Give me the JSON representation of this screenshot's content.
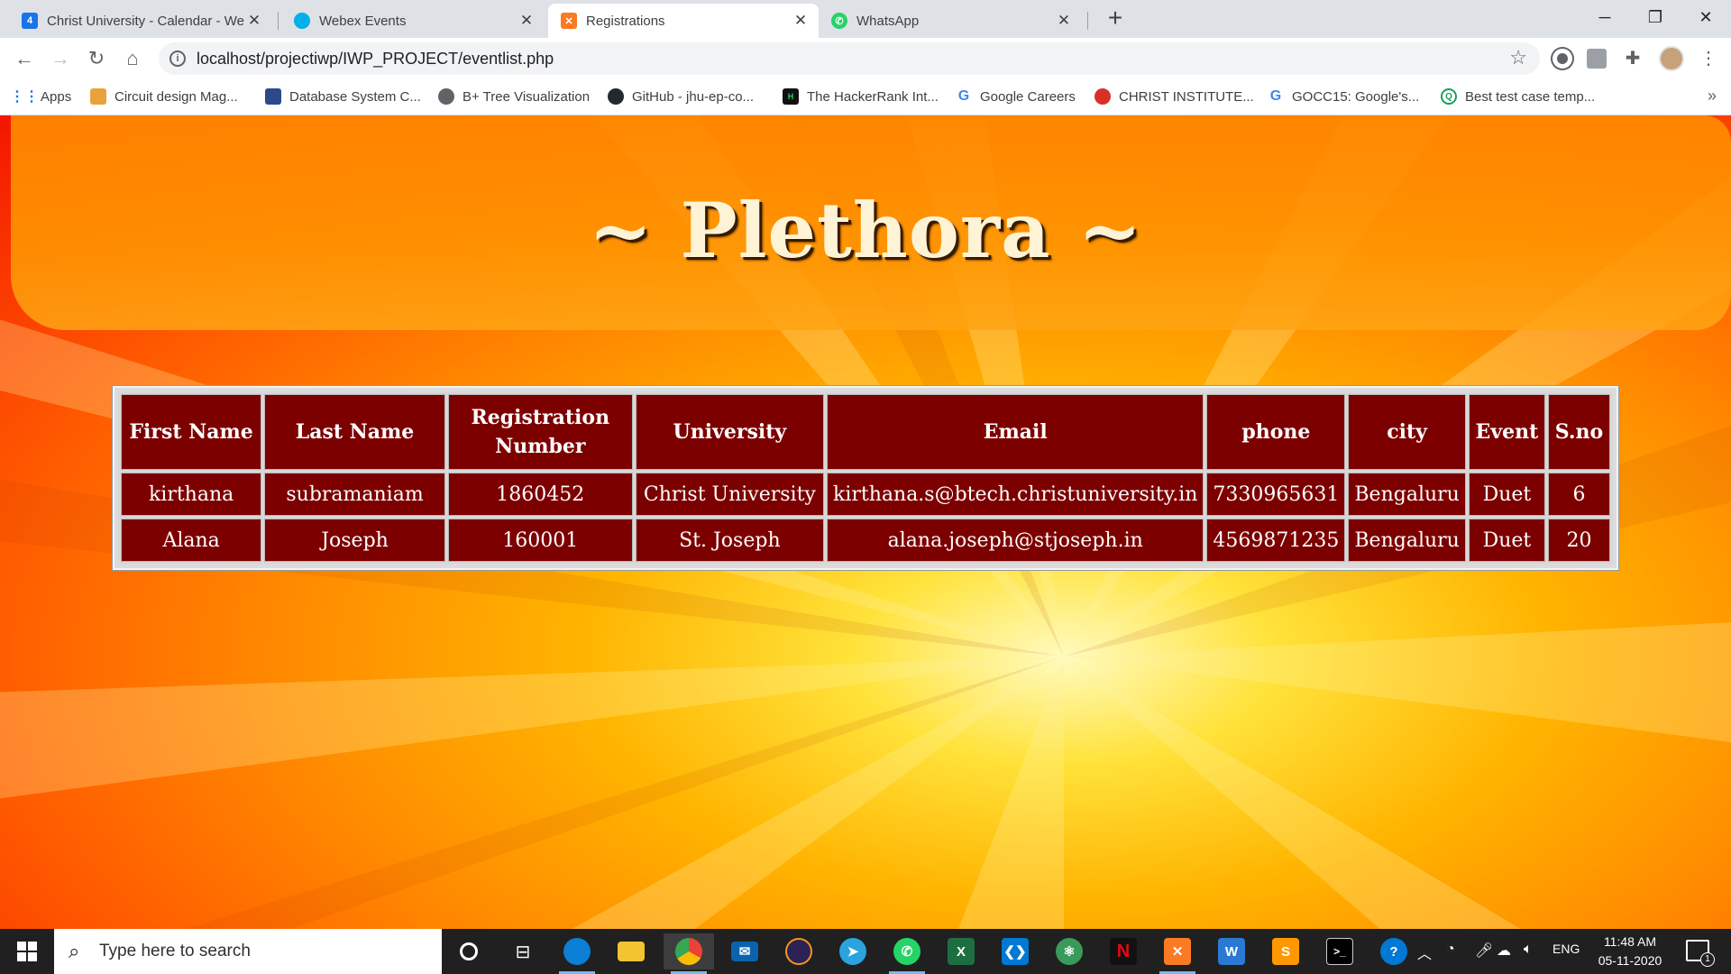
{
  "browser": {
    "tabs": [
      {
        "title": "Christ University - Calendar - We",
        "icon": "calendar-icon",
        "color": "#1a73e8"
      },
      {
        "title": "Webex Events",
        "icon": "webex-icon",
        "color": "#00b0ea"
      },
      {
        "title": "Registrations",
        "icon": "xampp-icon",
        "color": "#fb7a24"
      },
      {
        "title": "WhatsApp",
        "icon": "whatsapp-icon",
        "color": "#25d366"
      }
    ],
    "url": "localhost/projectiwp/IWP_PROJECT/eventlist.php",
    "bookmarks": [
      {
        "label": "Apps",
        "icon": "apps-grid-icon"
      },
      {
        "label": "Circuit design Mag...",
        "icon": "circuit-icon"
      },
      {
        "label": "Database System C...",
        "icon": "database-book-icon"
      },
      {
        "label": "B+ Tree Visualization",
        "icon": "globe-icon"
      },
      {
        "label": "GitHub - jhu-ep-co...",
        "icon": "github-icon"
      },
      {
        "label": "The HackerRank Int...",
        "icon": "hackerrank-icon"
      },
      {
        "label": "Google Careers",
        "icon": "google-icon"
      },
      {
        "label": "CHRIST INSTITUTE...",
        "icon": "christ-icon"
      },
      {
        "label": "GOCC15: Google's...",
        "icon": "google-icon"
      },
      {
        "label": "Best test case temp...",
        "icon": "search-q-icon"
      }
    ]
  },
  "page": {
    "title": "~ Plethora ~",
    "table": {
      "headers": [
        "First Name",
        "Last Name",
        "Registration Number",
        "University",
        "Email",
        "phone",
        "city",
        "Event",
        "S.no"
      ],
      "rows": [
        [
          "kirthana",
          "subramaniam",
          "1860452",
          "Christ University",
          "kirthana.s@btech.christuniversity.in",
          "7330965631",
          "Bengaluru",
          "Duet",
          "6"
        ],
        [
          "Alana",
          "Joseph",
          "160001",
          "St. Joseph",
          "alana.joseph@stjoseph.in",
          "4569871235",
          "Bengaluru",
          "Duet",
          "20"
        ]
      ]
    }
  },
  "taskbar": {
    "search_placeholder": "Type here to search",
    "language": "ENG",
    "time": "11:48 AM",
    "date": "05-11-2020",
    "notification_count": "1"
  },
  "colors": {
    "table_cell": "#7d0000",
    "title_text": "#fff3d6",
    "background_outer": "#f41500",
    "background_center": "#ffe23a"
  }
}
